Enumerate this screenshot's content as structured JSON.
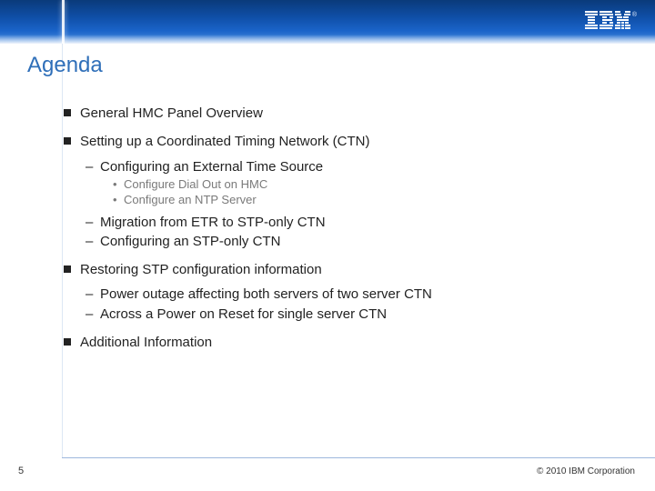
{
  "brand": {
    "logo_label": "IBM",
    "registered_mark": "®"
  },
  "title": "Agenda",
  "bullets": {
    "b1": "General HMC Panel Overview",
    "b2": "Setting up a Coordinated Timing Network (CTN)",
    "b2_1": "Configuring an External Time Source",
    "b2_1_a": "Configure Dial Out on HMC",
    "b2_1_b": "Configure an NTP Server",
    "b2_2": "Migration from ETR to STP-only CTN",
    "b2_3": "Configuring an STP-only CTN",
    "b3": "Restoring STP configuration information",
    "b3_1": "Power outage affecting both servers of two server CTN",
    "b3_2": "Across a Power on Reset for single server CTN",
    "b4": "Additional Information"
  },
  "footer": {
    "page_number": "5",
    "copyright": "© 2010 IBM Corporation"
  }
}
